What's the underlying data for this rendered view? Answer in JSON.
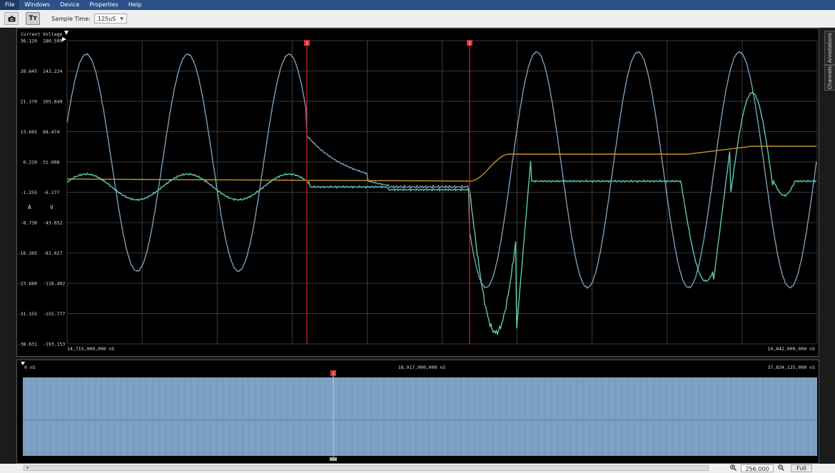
{
  "menu": {
    "items": [
      "File",
      "Windows",
      "Device",
      "Properties",
      "Help"
    ]
  },
  "toolbar": {
    "screenshot_icon": "camera-icon",
    "text_toggle_label": "Tт",
    "sample_time_label": "Sample Time:",
    "sample_time_value": "125uS"
  },
  "plot": {
    "current_header": "Current",
    "voltage_header": "Voltage",
    "current_ticks": [
      "36.120",
      "28.645",
      "21.170",
      "13.695",
      "6.220",
      "-1.255",
      "-8.730",
      "-16.205",
      "-23.680",
      "-31.155",
      "-38.631"
    ],
    "voltage_ticks": [
      "180.599",
      "143.224",
      "105.849",
      "68.474",
      "31.098",
      "-6.277",
      "-43.652",
      "-81.027",
      "-118.402",
      "-155.777",
      "-193.153"
    ],
    "current_unit": "A",
    "voltage_unit": "V",
    "x_start_label": "14,715,000,000 nS",
    "x_end_label": "14,842,000,000 nS",
    "cursor_labels": [
      "1",
      "2"
    ],
    "colors": {
      "background": "#000000",
      "grid": "#4a4a4a",
      "voltage_trace": "#7a9cb8",
      "current_trace": "#5ec8b2",
      "orange_trace": "#c8962a",
      "cursor": "#c81e1e"
    }
  },
  "overview": {
    "start_label": "0 nS",
    "mid_label": "18,917,000,000 nS",
    "end_label": "37,834,125,000 nS",
    "cursor_label": "1",
    "fill_color": "#7da2c4"
  },
  "side_tabs": [
    "Annotations",
    "Channels"
  ],
  "bottom": {
    "zoom_value": "256.000",
    "full_label": "Full",
    "zoom_in_icon": "zoom-in-icon",
    "zoom_out_icon": "zoom-out-icon"
  }
}
